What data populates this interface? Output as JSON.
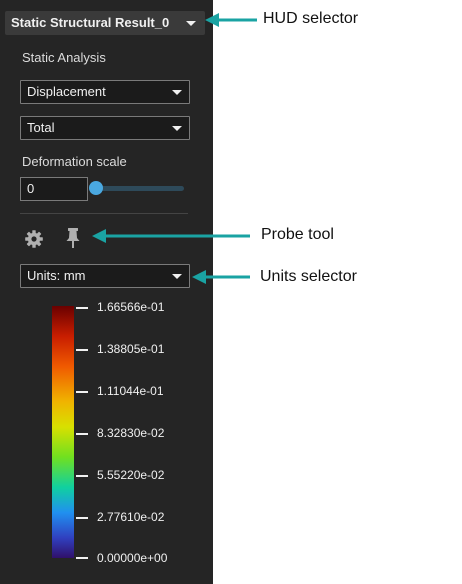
{
  "hud": {
    "label": "Static Structural Result_0"
  },
  "analysis": {
    "title": "Static Analysis"
  },
  "result_type": {
    "selected": "Displacement"
  },
  "component": {
    "selected": "Total"
  },
  "deformation": {
    "label": "Deformation scale",
    "value": "0",
    "slider_fraction": 0
  },
  "units": {
    "selected": "Units: mm"
  },
  "legend": {
    "ticks": [
      "1.66566e-01",
      "1.38805e-01",
      "1.11044e-01",
      "8.32830e-02",
      "5.55220e-02",
      "2.77610e-02",
      "0.00000e+00"
    ]
  },
  "callouts": {
    "hud": "HUD selector",
    "probe": "Probe tool",
    "units": "Units selector"
  },
  "colors": {
    "panel": "#252525",
    "accent": "#1aa3a3",
    "slider": "#4aa8e0"
  },
  "icons": [
    "chevron-down-icon",
    "gear-icon",
    "pin-icon",
    "arrow-left-icon"
  ]
}
